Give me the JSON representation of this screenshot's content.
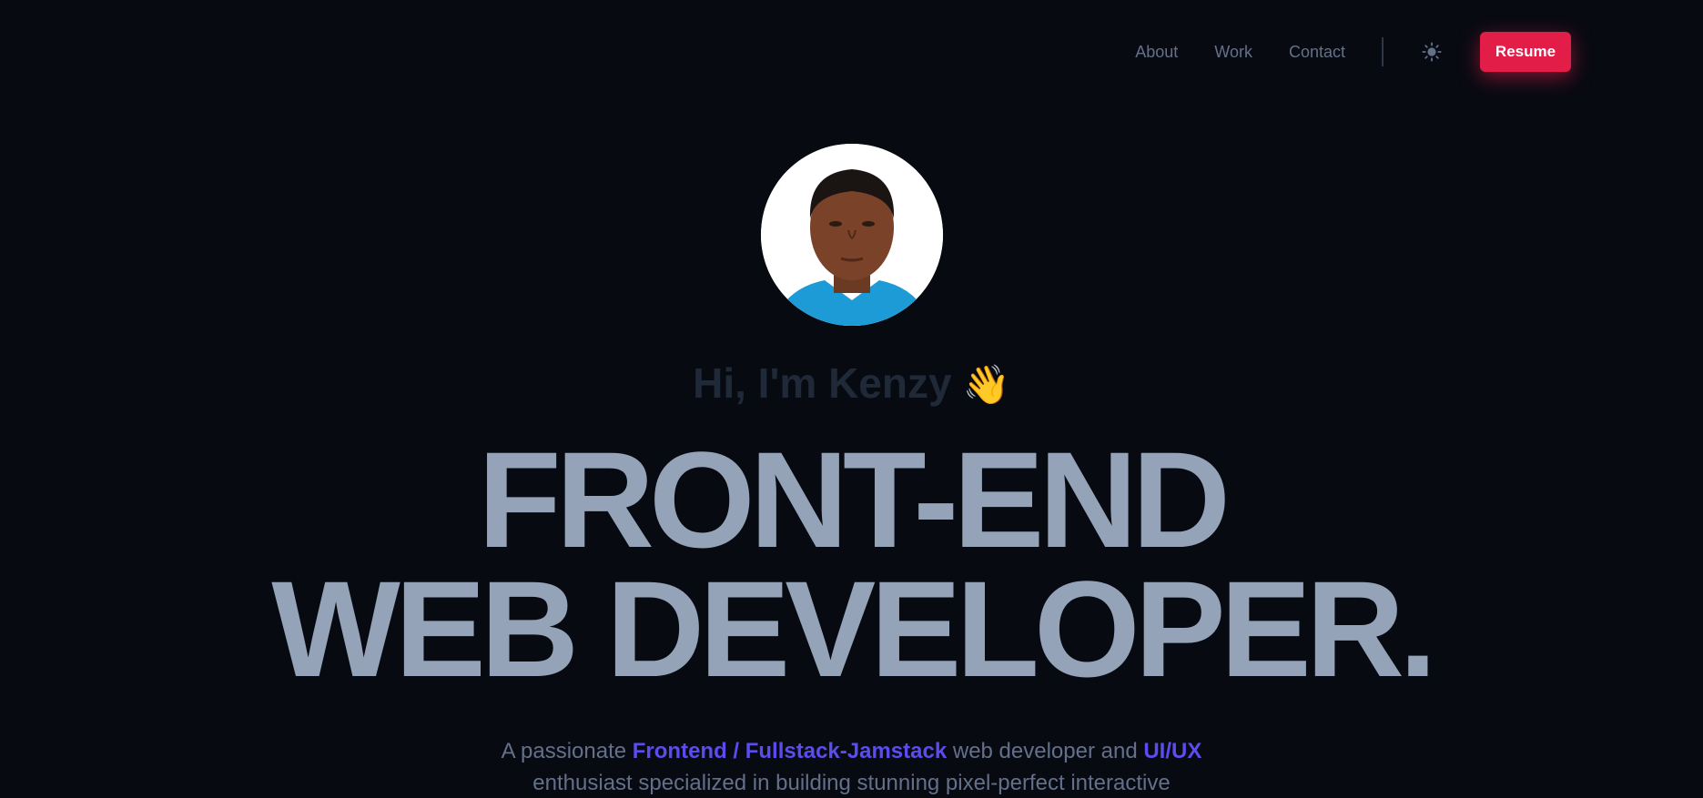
{
  "nav": {
    "links": [
      "About",
      "Work",
      "Contact"
    ],
    "theme_toggle_icon": "sun-icon",
    "resume_label": "Resume"
  },
  "hero": {
    "greeting": "Hi, I'm Kenzy",
    "greeting_emoji": "👋",
    "headline_line1": "FRONT-END",
    "headline_line2": "WEB DEVELOPER.",
    "intro": {
      "part1": "A passionate ",
      "highlight1": "Frontend / Fullstack-Jamstack",
      "part2": " web developer and ",
      "highlight2": "UI/UX",
      "part3": " enthusiast specialized in building stunning pixel-perfect interactive"
    }
  },
  "colors": {
    "background": "#080a12",
    "accent": "#e11d48",
    "highlight": "#5b4cf0",
    "headline": "#94a3b8"
  }
}
